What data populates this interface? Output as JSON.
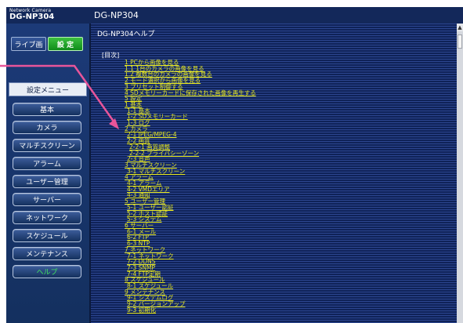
{
  "header": {
    "brand_small": "Network Camera",
    "brand_model": "DG-NP304",
    "page_model": "DG-NP304"
  },
  "mode": {
    "live_label": "ライブ画",
    "setup_label": "設 定"
  },
  "sidebar": {
    "menu_title": "設定メニュー",
    "items": [
      "基本",
      "カメラ",
      "マルチスクリーン",
      "アラーム",
      "ユーザー管理",
      "サーバー",
      "ネットワーク",
      "スケジュール",
      "メンテナンス"
    ],
    "help_label": "ヘルプ"
  },
  "content": {
    "help_title": "DG-NP304ヘルプ",
    "toc_head": "[目次]",
    "toc": [
      {
        "label": "1 PCから画像を見る",
        "level": 1
      },
      {
        "label": "1.1 1台のカメラの画像を見る",
        "level": 1
      },
      {
        "label": "1.2 複数台のカメラの画像を見る",
        "level": 1
      },
      {
        "label": "2 モード選択から画像を見る",
        "level": 1
      },
      {
        "label": "3 プリセット制御する",
        "level": 1
      },
      {
        "label": "4 SDメモリーカードに保存された画像を再生する",
        "level": 1
      },
      {
        "label": "5 設定",
        "level": 1
      },
      {
        "label": "1 基本",
        "level": 1
      },
      {
        "label": "1-1 基本",
        "level": 2
      },
      {
        "label": "1-2 SDメモリーカード",
        "level": 2
      },
      {
        "label": "1-3 ログ",
        "level": 2
      },
      {
        "label": "2 カメラ",
        "level": 1
      },
      {
        "label": "2-1 JPEG/MPEG-4",
        "level": 2
      },
      {
        "label": "2-2 画質",
        "level": 2
      },
      {
        "label": "2-2-1 画質調整",
        "level": 3
      },
      {
        "label": "2-2-2 プライバシーゾーン",
        "level": 3
      },
      {
        "label": "2-3 音声",
        "level": 2
      },
      {
        "label": "3 マルチスクリーン",
        "level": 1
      },
      {
        "label": "3-1 マルチスクリーン",
        "level": 2
      },
      {
        "label": "4 アラーム",
        "level": 1
      },
      {
        "label": "4-1 アラーム",
        "level": 2
      },
      {
        "label": "4-2 VMDエリア",
        "level": 2
      },
      {
        "label": "4-3 通知",
        "level": 2
      },
      {
        "label": "5 ユーザー管理",
        "level": 1
      },
      {
        "label": "5-1 ユーザー認証",
        "level": 2
      },
      {
        "label": "5-2 ホスト認証",
        "level": 2
      },
      {
        "label": "5-3 システム",
        "level": 2
      },
      {
        "label": "6 サーバー",
        "level": 1
      },
      {
        "label": "6-1 メール",
        "level": 2
      },
      {
        "label": "6-2 FTP",
        "level": 2
      },
      {
        "label": "6-3 NTP",
        "level": 2
      },
      {
        "label": "7 ネットワーク",
        "level": 1
      },
      {
        "label": "7-1 ネットワーク",
        "level": 2
      },
      {
        "label": "7-2 DDNS",
        "level": 2
      },
      {
        "label": "7-3 SNMP",
        "level": 2
      },
      {
        "label": "7-4 FTP定期",
        "level": 2
      },
      {
        "label": "8 スケジュール",
        "level": 1
      },
      {
        "label": "8-1 スケジュール",
        "level": 2
      },
      {
        "label": "9 メンテナンス",
        "level": 1
      },
      {
        "label": "9-1 システムログ",
        "level": 2
      },
      {
        "label": "9-2 バージョンアップ",
        "level": 2
      },
      {
        "label": "9-3 初期化",
        "level": 2
      }
    ]
  },
  "colors": {
    "background": "#13285a",
    "link": "#e8e820",
    "active_green": "#1fa82a",
    "pointer_arrow": "#e8559a"
  }
}
